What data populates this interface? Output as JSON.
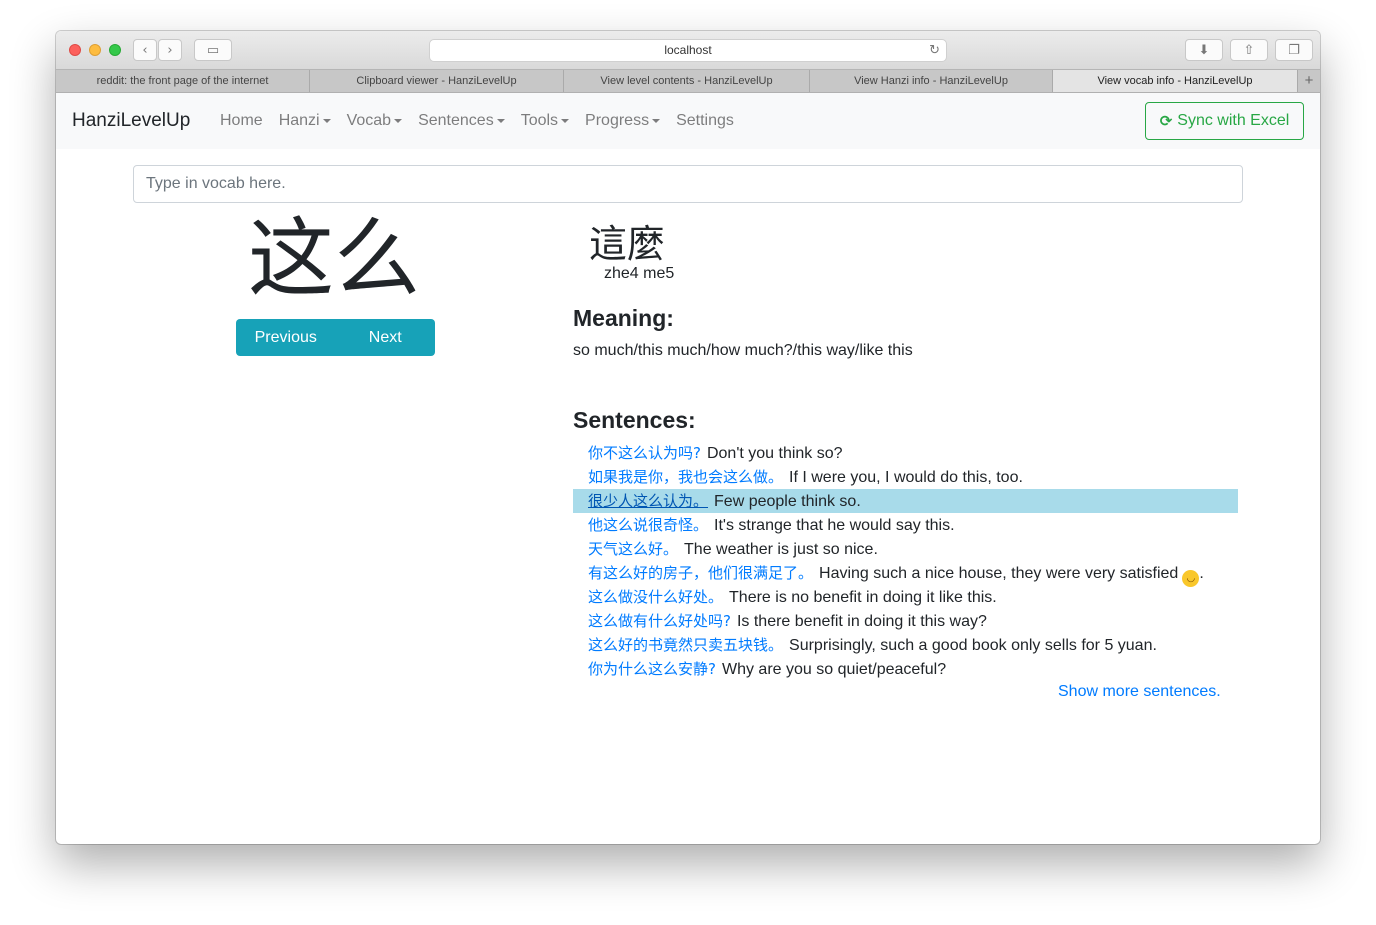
{
  "browser": {
    "url": "localhost",
    "tabs": [
      {
        "title": "reddit: the front page of the internet",
        "active": false
      },
      {
        "title": "Clipboard viewer - HanziLevelUp",
        "active": false
      },
      {
        "title": "View level contents - HanziLevelUp",
        "active": false
      },
      {
        "title": "View Hanzi info - HanziLevelUp",
        "active": false
      },
      {
        "title": "View vocab info - HanziLevelUp",
        "active": true
      }
    ],
    "new_tab": "+"
  },
  "navbar": {
    "brand": "HanziLevelUp",
    "links": [
      {
        "label": "Home",
        "dropdown": false
      },
      {
        "label": "Hanzi",
        "dropdown": true
      },
      {
        "label": "Vocab",
        "dropdown": true
      },
      {
        "label": "Sentences",
        "dropdown": true
      },
      {
        "label": "Tools",
        "dropdown": true
      },
      {
        "label": "Progress",
        "dropdown": true
      },
      {
        "label": "Settings",
        "dropdown": false
      }
    ],
    "sync_label": "Sync with Excel",
    "sync_color": "#28a745"
  },
  "search": {
    "placeholder": "Type in vocab here."
  },
  "vocab": {
    "simplified": "这么",
    "traditional": "這麼",
    "pinyin": "zhe4 me5",
    "previous_label": "Previous",
    "next_label": "Next"
  },
  "meaning": {
    "heading": "Meaning:",
    "text": "so much/this much/how much?/this way/like this"
  },
  "sentences": {
    "heading": "Sentences:",
    "items": [
      {
        "zh": "你不这么认为吗?",
        "en": "Don't you think so?"
      },
      {
        "zh": "如果我是你，我也会这么做。",
        "en": "If I were you, I would do this, too."
      },
      {
        "zh": "很少人这么认为。",
        "en": "Few people think so."
      },
      {
        "zh": "他这么说很奇怪。",
        "en": "It's strange that he would say this."
      },
      {
        "zh": "天气这么好。",
        "en": "The weather is just so nice."
      },
      {
        "zh": "有这么好的房子，他们很满足了。",
        "en": "Having such a nice house, they were very satisfied",
        "emoji": true,
        "after": "."
      },
      {
        "zh": "这么做没什么好处。",
        "en": "There is no benefit in doing it like this."
      },
      {
        "zh": "这么做有什么好处吗?",
        "en": "Is there benefit in doing it this way?"
      },
      {
        "zh": "这么好的书竟然只卖五块钱。",
        "en": "Surprisingly, such a good book only sells for 5 yuan."
      },
      {
        "zh": "你为什么这么安静?",
        "en": "Why are you so quiet/peaceful?"
      }
    ],
    "highlighted_index": 2,
    "show_more": "Show more sentences.",
    "link_color": "#007bff",
    "highlight_color": "#a8dbea"
  }
}
